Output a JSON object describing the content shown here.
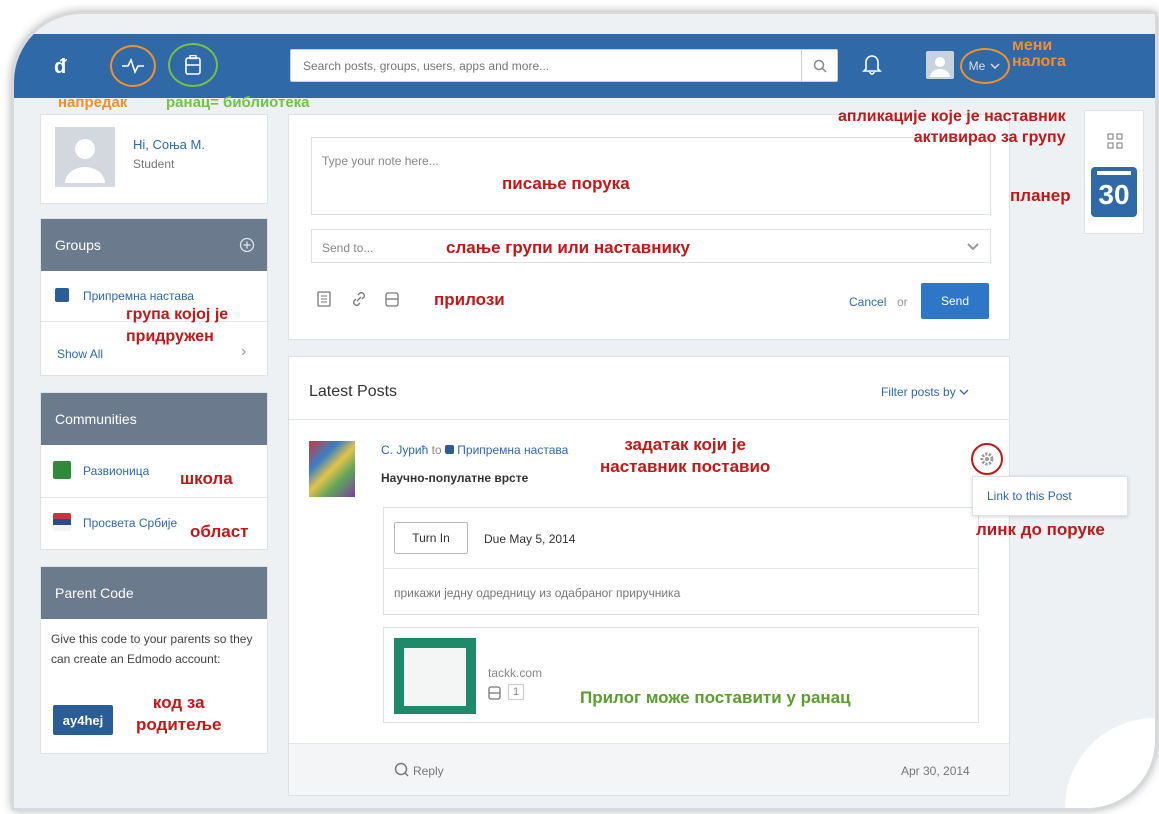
{
  "topbar": {
    "logo": "ᵭ",
    "search_placeholder": "Search posts, groups, users, apps and more...",
    "me_label": "Me",
    "icons": [
      "progress-icon",
      "backpack-icon",
      "search-icon",
      "bell-icon",
      "avatar",
      "chevron-down-icon"
    ]
  },
  "annotations": {
    "progress": "напредак",
    "backpack": "ранац= библиотека",
    "account_menu": "мени\nналога",
    "apps": "апликације које је наставник\nактивирао за групу",
    "planner": "планер",
    "writing": "писање порука",
    "send_to": "слање групи или наставнику",
    "attachments": "прилози",
    "joined_group": "група којој је\nпридружен",
    "school": "школа",
    "area": "област",
    "parent_code": "код за\nродитеље",
    "task": "задатак који је\nнаставник поставио",
    "link_to_post": "линк до поруке",
    "attachment_backpack": "Прилог може поставити у ранац"
  },
  "profile": {
    "greeting": "Hi, Соња М.",
    "role": "Student"
  },
  "groups": {
    "title": "Groups",
    "items": [
      "Припремна настава"
    ],
    "show_all": "Show All"
  },
  "communities": {
    "title": "Communities",
    "items": [
      "Развионица",
      "Просвета Србије"
    ]
  },
  "parent_code": {
    "title": "Parent Code",
    "text": "Give this code to your parents so they can create an Edmodo account:",
    "code": "ay4hej"
  },
  "composer": {
    "note_placeholder": "Type your note here...",
    "send_to_placeholder": "Send to...",
    "cancel": "Cancel",
    "or": "or",
    "send": "Send"
  },
  "posts": {
    "title": "Latest Posts",
    "filter": "Filter posts by",
    "post": {
      "author": "С. Јурић",
      "to": "to",
      "group": "Припремна настава",
      "title": "Научно-популатне врсте",
      "turn_in": "Turn In",
      "due": "Due May 5, 2014",
      "body": "прикажи једну одредницу из одабраног приручника",
      "link_domain": "tackk.com",
      "backpack_count": "1",
      "reply": "Reply",
      "date": "Apr 30, 2014",
      "menu_item": "Link to this Post"
    }
  },
  "planner": {
    "day": "30"
  },
  "colors": {
    "topbar": "#2f69a8",
    "card_header": "#6c7a8e",
    "button": "#2e77c8",
    "annotation_red": "#c01818",
    "annotation_orange": "#f0902c",
    "annotation_green": "#77c043"
  }
}
